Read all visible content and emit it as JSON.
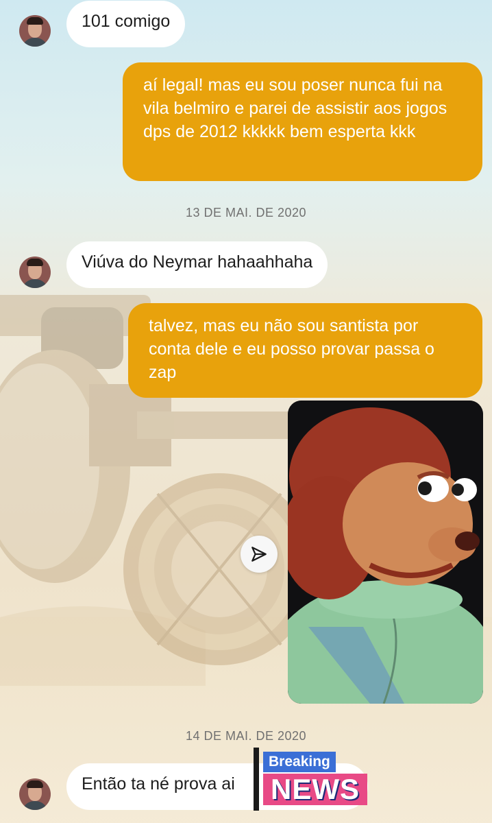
{
  "messages": {
    "m1": "101 comigo",
    "m2": "aí legal! mas eu sou poser nunca fui na vila belmiro e parei de assistir aos jogos dps de 2012 kkkkk bem esperta kkk",
    "m3": "Viúva do Neymar hahaahhaha",
    "m4": "talvez, mas eu não sou santista por conta dele e eu posso provar passa o zap",
    "m5": "Então ta né prova ai"
  },
  "dates": {
    "d1": "13 DE MAI. DE 2020",
    "d2": "14 DE MAI. DE 2020"
  },
  "sticker": {
    "top": "Breaking",
    "bottom": "NEWS"
  },
  "icons": {
    "share": "paper-plane-icon"
  },
  "colors": {
    "outgoing_bubble": "#e8a20c",
    "incoming_bubble": "#ffffff",
    "date_text": "#707070"
  }
}
